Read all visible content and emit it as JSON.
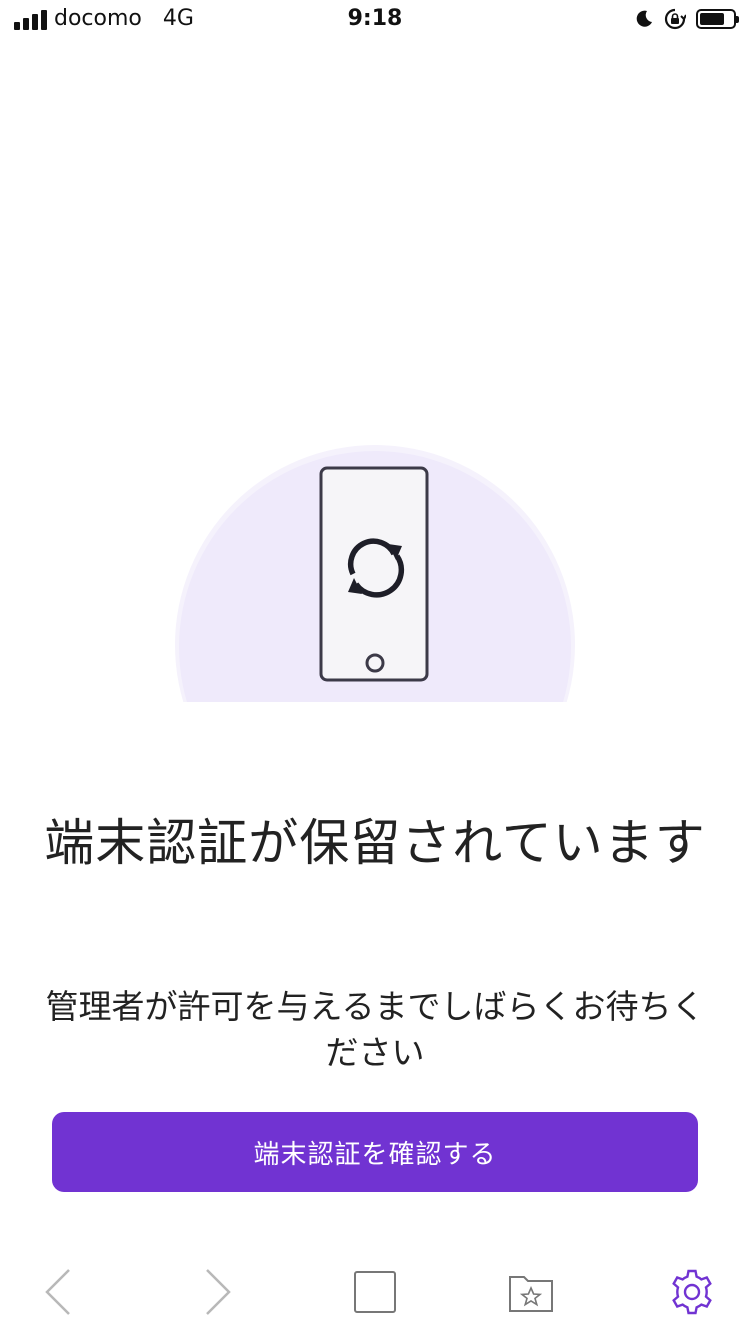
{
  "status_bar": {
    "carrier": "docomo",
    "network": "4G",
    "time": "9:18",
    "icons": [
      "signal-icon",
      "moon-icon",
      "rotation-lock-icon",
      "battery-icon"
    ],
    "battery_level_percent": 75
  },
  "illustration": {
    "icons": [
      "phone-icon",
      "sync-icon"
    ],
    "circle_color": "#efeafb"
  },
  "main": {
    "title": "端末認証が保留されています",
    "subtitle": "管理者が許可を与えるまでしばらくお待ちください",
    "confirm_button_label": "端末認証を確認する"
  },
  "toolbar": {
    "items": [
      "back-icon",
      "forward-icon",
      "tabs-icon",
      "bookmark-folder-icon",
      "settings-icon"
    ]
  },
  "colors": {
    "accent": "#7133d2",
    "text": "#222222",
    "inactive_icon": "#b8b8b8"
  }
}
